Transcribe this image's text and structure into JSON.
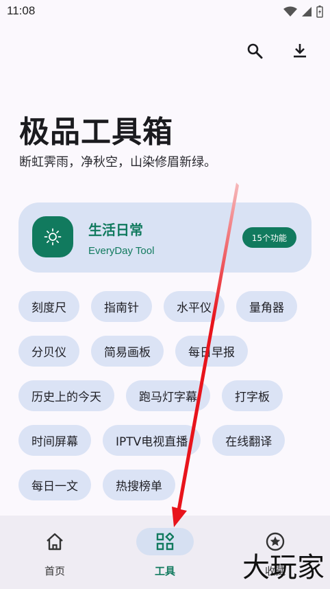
{
  "status_bar": {
    "time": "11:08"
  },
  "header": {
    "title": "极品工具箱",
    "subtitle": "断虹霁雨，净秋空，山染修眉新绿。"
  },
  "category": {
    "title": "生活日常",
    "subtitle": "EveryDay Tool",
    "badge": "15个功能",
    "icon": "sun-icon"
  },
  "tools": [
    "刻度尺",
    "指南针",
    "水平仪",
    "量角器",
    "分贝仪",
    "简易画板",
    "每日早报",
    "历史上的今天",
    "跑马灯字幕",
    "打字板",
    "时间屏幕",
    "IPTV电视直播",
    "在线翻译",
    "每日一文",
    "热搜榜单"
  ],
  "nav": {
    "items": [
      {
        "label": "首页",
        "icon": "home-icon"
      },
      {
        "label": "工具",
        "icon": "grid-icon",
        "active": true
      },
      {
        "label": "收藏",
        "icon": "star-icon"
      }
    ]
  },
  "watermark": "大玩家",
  "colors": {
    "accent": "#117a5e",
    "chip": "#dbe3f5",
    "card": "#d9e2f4",
    "arrow": "#e8141c"
  }
}
